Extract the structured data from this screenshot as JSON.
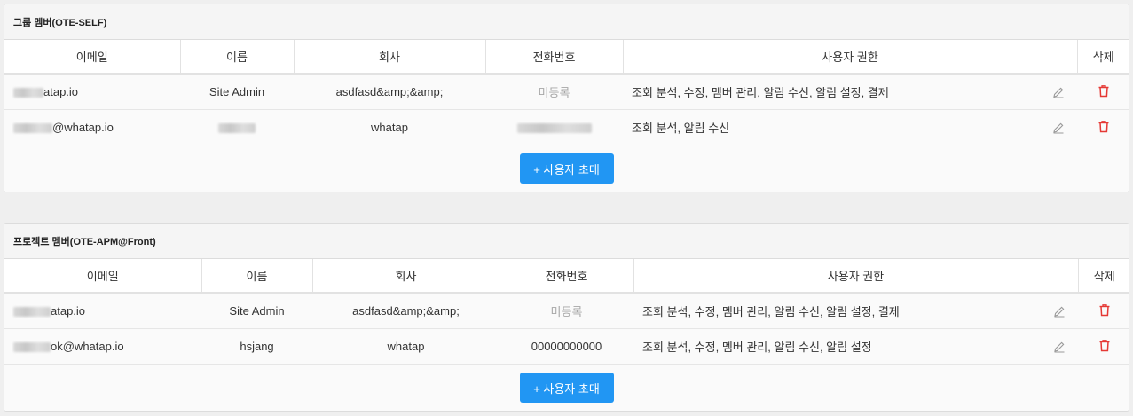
{
  "columns": {
    "email": "이메일",
    "name": "이름",
    "company": "회사",
    "phone": "전화번호",
    "permission": "사용자 권한",
    "delete": "삭제"
  },
  "group": {
    "title": "그룹 멤버(OTE-SELF)",
    "invite_label": "+ 사용자 초대",
    "rows": [
      {
        "email": "atap.io",
        "name": "Site Admin",
        "company": "asdfasd&amp;&amp;",
        "phone": "미등록",
        "permission": "조회 분석, 수정, 멤버 관리, 알림 수신, 알림 설정, 결제"
      },
      {
        "email": "@whatap.io",
        "name": "",
        "company": "whatap",
        "phone": "",
        "permission": "조회 분석, 알림 수신"
      }
    ]
  },
  "project": {
    "title": "프로젝트 멤버(OTE-APM@Front)",
    "invite_label": "+ 사용자 초대",
    "rows": [
      {
        "email": "atap.io",
        "name": "Site Admin",
        "company": "asdfasd&amp;&amp;",
        "phone": "미등록",
        "permission": "조회 분석, 수정, 멤버 관리, 알림 수신, 알림 설정, 결제"
      },
      {
        "email": "ok@whatap.io",
        "name": "hsjang",
        "company": "whatap",
        "phone": "00000000000",
        "permission": "조회 분석, 수정, 멤버 관리, 알림 수신, 알림 설정"
      }
    ]
  },
  "icons": {
    "edit": "pencil-icon",
    "delete": "trash-icon",
    "delete_color": "#e53935",
    "accent": "#2196f3"
  }
}
